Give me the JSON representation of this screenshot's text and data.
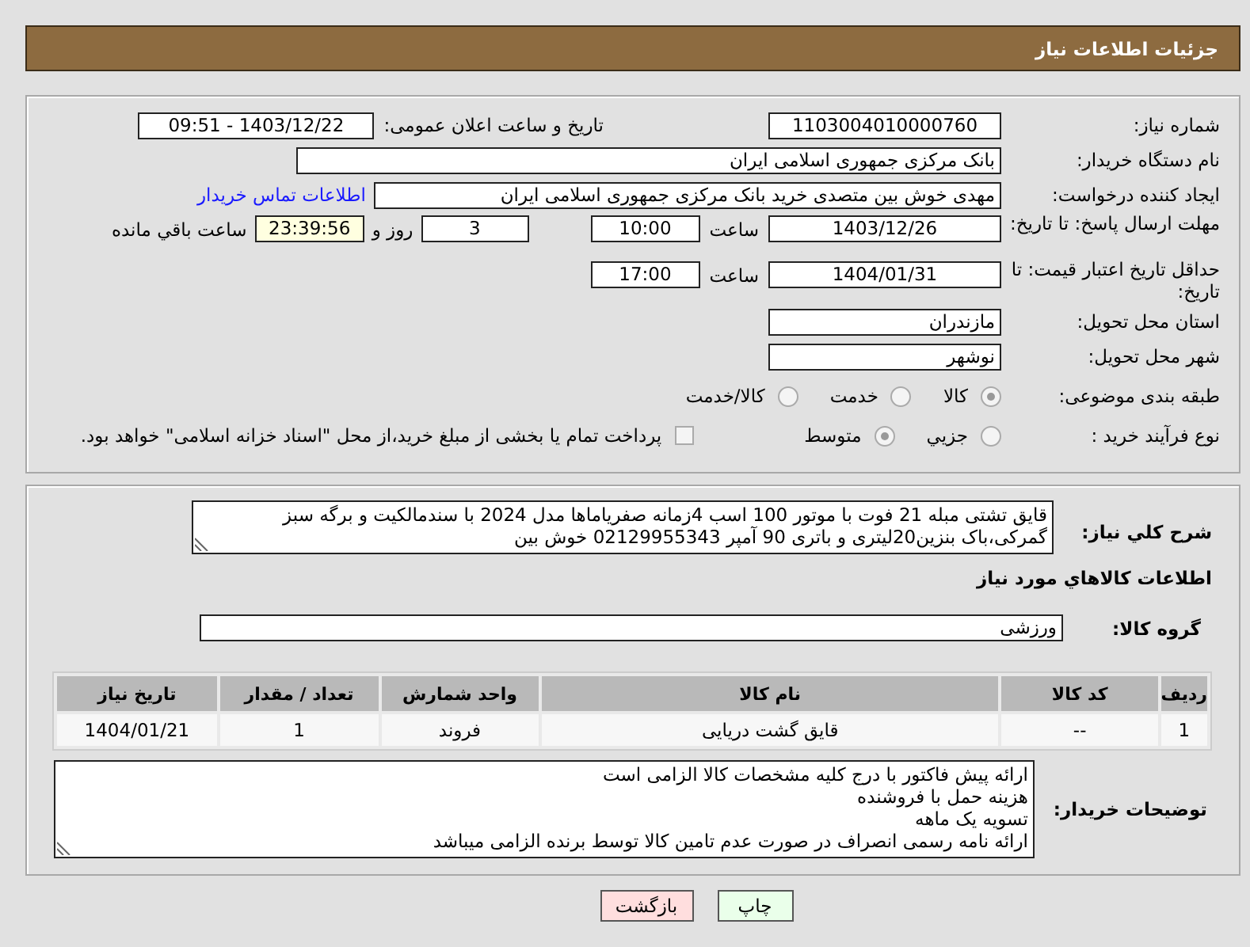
{
  "header": {
    "title": "جزئیات اطلاعات نیاز"
  },
  "form": {
    "need_number": {
      "label": "شماره نیاز:",
      "value": "1103004010000760"
    },
    "announce": {
      "label": "تاریخ و ساعت اعلان عمومی:",
      "value": "1403/12/22 - 09:51"
    },
    "buyer_org": {
      "label": "نام دستگاه خریدار:",
      "value": "بانک مرکزی جمهوری اسلامی ایران"
    },
    "creator": {
      "label": "ایجاد کننده درخواست:",
      "value": "مهدی خوش بین متصدی خرید بانک مرکزی جمهوری اسلامی ایران",
      "link": "اطلاعات تماس خریدار"
    },
    "reply_deadline": {
      "label": "مهلت ارسال پاسخ: تا تاریخ:",
      "date": "1403/12/26",
      "time_label": "ساعت",
      "time": "10:00",
      "days": "3",
      "days_label": "روز و",
      "remaining": "23:39:56",
      "remaining_label": "ساعت باقي مانده"
    },
    "price_validity": {
      "label": "حداقل تاریخ اعتبار قیمت: تا تاریخ:",
      "date": "1404/01/31",
      "time_label": "ساعت",
      "time": "17:00"
    },
    "province": {
      "label": "استان محل تحویل:",
      "value": "مازندران"
    },
    "city": {
      "label": "شهر محل تحویل:",
      "value": "نوشهر"
    },
    "category": {
      "label": "طبقه بندی موضوعی:",
      "disabled": true,
      "options": [
        {
          "label": "کالا",
          "selected": true
        },
        {
          "label": "خدمت",
          "selected": false
        },
        {
          "label": "کالا/خدمت",
          "selected": false
        }
      ]
    },
    "process": {
      "label": "نوع فرآیند خرید :",
      "disabled": true,
      "options": [
        {
          "label": "جزيي",
          "selected": false
        },
        {
          "label": "متوسط",
          "selected": true
        }
      ],
      "treasury": {
        "label": "پرداخت تمام یا بخشی از مبلغ خرید،از محل \"اسناد خزانه اسلامی\" خواهد بود.",
        "checked": false
      }
    }
  },
  "description": {
    "label": "شرح کلي نیاز:",
    "text": "قایق تشتی مبله 21 فوت با موتور 100 اسب 4زمانه صفریاماها مدل 2024 با سندمالکیت و برگه سبز گمرکی،باک بنزین20لیتری و باتری 90 آمپر 02129955343 خوش بین"
  },
  "items": {
    "title": "اطلاعات کالاهاي مورد نیاز",
    "group": {
      "label": "گروه کالا:",
      "value": "ورزشی"
    },
    "table": {
      "columns": [
        "ردیف",
        "کد کالا",
        "نام کالا",
        "واحد شمارش",
        "تعداد / مقدار",
        "تاریخ نیاز"
      ],
      "rows": [
        [
          "1",
          "--",
          "قایق گشت دریایی",
          "فروند",
          "1",
          "1404/01/21"
        ]
      ]
    }
  },
  "notes": {
    "label": "توضیحات خریدار:",
    "lines": [
      "ارائه پیش فاکتور با درج کلیه مشخصات کالا الزامی است",
      "هزینه حمل با فروشنده",
      "تسویه یک ماهه",
      "ارائه نامه رسمی انصراف در صورت عدم تامین کالا توسط برنده الزامی میباشد"
    ]
  },
  "buttons": [
    {
      "label": "چاپ",
      "kind": "print"
    },
    {
      "label": "بازگشت",
      "kind": "back"
    }
  ]
}
